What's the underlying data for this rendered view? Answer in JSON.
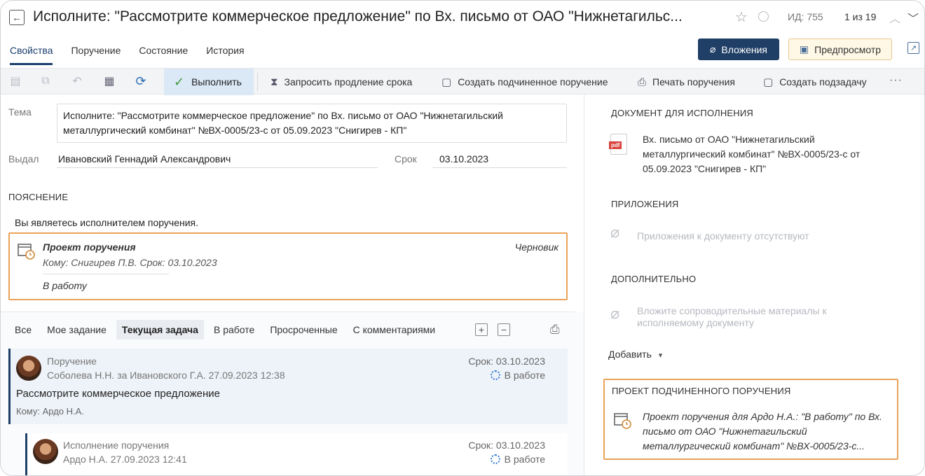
{
  "header": {
    "title": "Исполните: \"Рассмотрите коммерческое предложение\" по Вх. письмо от ОАО \"Нижнетагильс...",
    "doc_id": "ИД: 755",
    "pager": "1 из 19"
  },
  "tabs": [
    "Свойства",
    "Поручение",
    "Состояние",
    "История"
  ],
  "buttons": {
    "attachments": "Вложения",
    "preview": "Предпросмотр"
  },
  "toolbar": {
    "run": "Выполнить",
    "extend": "Запросить продление срока",
    "create_sub": "Создать подчиненное поручение",
    "print": "Печать поручения",
    "create_subtask": "Создать подзадачу",
    "more": "···"
  },
  "form": {
    "subject_label": "Тема",
    "subject_value": "Исполните: \"Рассмотрите коммерческое предложение\" по Вх. письмо от ОАО \"Нижнетагильский металлургический комбинат\" №ВХ-0005/23-с от 05.09.2023 \"Снигирев - КП\"",
    "issued_label": "Выдал",
    "issued_value": "Ивановский Геннадий Александрович",
    "due_label": "Срок",
    "due_value": "03.10.2023",
    "explanation_header": "ПОЯСНЕНИЕ",
    "explanation_text": "Вы являетесь исполнителем поручения."
  },
  "draft": {
    "title": "Проект поручения",
    "meta": "Кому: Снигирев П.В.  Срок: 03.10.2023",
    "status": "Черновик",
    "action": "В работу"
  },
  "filters": [
    "Все",
    "Мое задание",
    "Текущая задача",
    "В работе",
    "Просроченные",
    "С комментариями"
  ],
  "filter_buttons": {
    "expand": "+",
    "collapse": "−"
  },
  "tasks": [
    {
      "type": "Поручение",
      "author": "Соболева Н.Н. за Ивановского Г.А.  27.09.2023 12:38",
      "due": "Срок: 03.10.2023",
      "status": "В работе",
      "subject": "Рассмотрите коммерческое предложение",
      "to": "Кому: Ардо Н.А."
    },
    {
      "type": "Исполнение поручения",
      "author": "Ардо Н.А.  27.09.2023 12:41",
      "due": "Срок: 03.10.2023",
      "status": "В работе"
    }
  ],
  "right": {
    "doc_header": "ДОКУМЕНТ ДЛЯ ИСПОЛНЕНИЯ",
    "doc_icon_label": "pdf",
    "doc_text": "Вх. письмо от ОАО \"Нижнетагильский металлургический комбинат\" №ВХ-0005/23-с от 05.09.2023 \"Снигирев - КП\"",
    "attach_header": "ПРИЛОЖЕНИЯ",
    "attach_empty": "Приложения к документу отсутствуют",
    "extra_header": "ДОПОЛНИТЕЛЬНО",
    "extra_hint": "Вложите сопроводительные материалы к исполняемому документу",
    "add_label": "Добавить",
    "sub_header": "ПРОЕКТ ПОДЧИНЕННОГО ПОРУЧЕНИЯ",
    "sub_text": "Проект поручения для Ардо Н.А.: \"В работу\" по Вх. письмо от ОАО \"Нижнетагильский металлургический комбинат\" №ВХ-0005/23-с..."
  },
  "colors": {
    "primary": "#1f3f66",
    "highlight_border": "#e9a25a",
    "run_bg": "#dbe8f6",
    "card_bg": "#eef3f9"
  },
  "icons": [
    "back-icon",
    "star-icon",
    "circle-icon",
    "chevron-up-icon",
    "chevron-down-icon",
    "paperclip-icon",
    "preview-icon",
    "popout-icon",
    "save-icon",
    "copy-icon",
    "undo-icon",
    "document-icon",
    "refresh-icon",
    "check-icon",
    "hourglass-icon",
    "calendar-icon",
    "print-icon",
    "pdf-icon",
    "spinner-icon"
  ]
}
